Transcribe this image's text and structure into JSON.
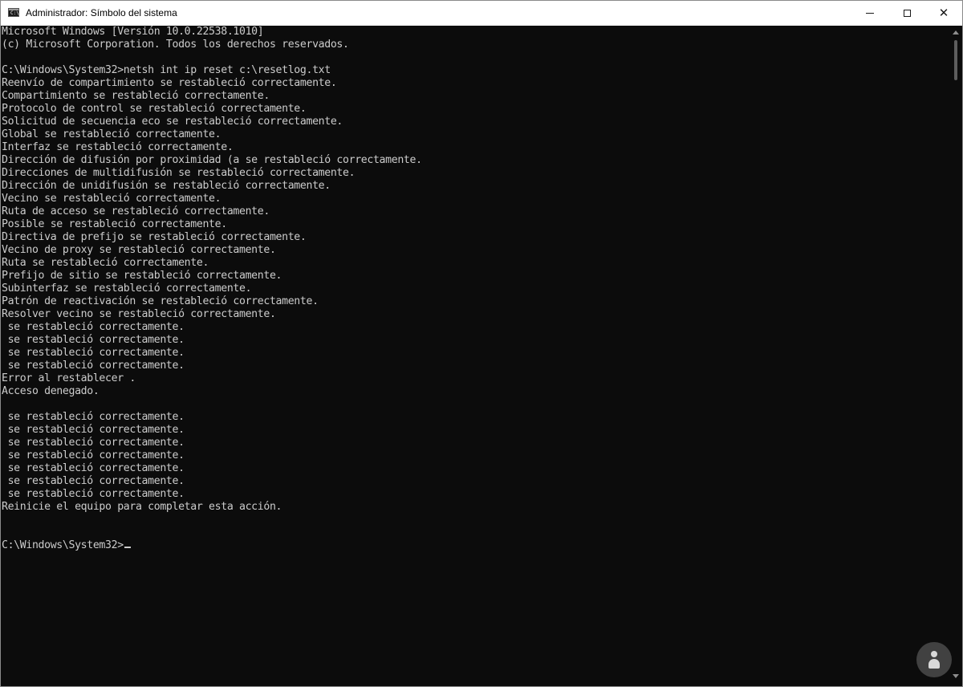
{
  "window": {
    "title": "Administrador: Símbolo del sistema",
    "app_icon_text": "C:\\",
    "minimize_label": "",
    "maximize_label": "",
    "close_label": "✕"
  },
  "console": {
    "lines": [
      "Microsoft Windows [Versión 10.0.22538.1010]",
      "(c) Microsoft Corporation. Todos los derechos reservados.",
      "",
      "C:\\Windows\\System32>netsh int ip reset c:\\resetlog.txt",
      "Reenvío de compartimiento se restableció correctamente.",
      "Compartimiento se restableció correctamente.",
      "Protocolo de control se restableció correctamente.",
      "Solicitud de secuencia eco se restableció correctamente.",
      "Global se restableció correctamente.",
      "Interfaz se restableció correctamente.",
      "Dirección de difusión por proximidad (a se restableció correctamente.",
      "Direcciones de multidifusión se restableció correctamente.",
      "Dirección de unidifusión se restableció correctamente.",
      "Vecino se restableció correctamente.",
      "Ruta de acceso se restableció correctamente.",
      "Posible se restableció correctamente.",
      "Directiva de prefijo se restableció correctamente.",
      "Vecino de proxy se restableció correctamente.",
      "Ruta se restableció correctamente.",
      "Prefijo de sitio se restableció correctamente.",
      "Subinterfaz se restableció correctamente.",
      "Patrón de reactivación se restableció correctamente.",
      "Resolver vecino se restableció correctamente.",
      " se restableció correctamente.",
      " se restableció correctamente.",
      " se restableció correctamente.",
      " se restableció correctamente.",
      "Error al restablecer .",
      "Acceso denegado.",
      "",
      " se restableció correctamente.",
      " se restableció correctamente.",
      " se restableció correctamente.",
      " se restableció correctamente.",
      " se restableció correctamente.",
      " se restableció correctamente.",
      " se restableció correctamente.",
      "Reinicie el equipo para completar esta acción.",
      "",
      "",
      "C:\\Windows\\System32>"
    ]
  },
  "colors": {
    "console_background": "#0c0c0c",
    "console_text": "#cccccc",
    "titlebar_background": "#ffffff"
  },
  "icons": {
    "app": "cmd-icon",
    "minimize": "minimize-icon",
    "maximize": "maximize-icon",
    "close": "close-icon",
    "watermark": "watermark-logo-icon"
  }
}
